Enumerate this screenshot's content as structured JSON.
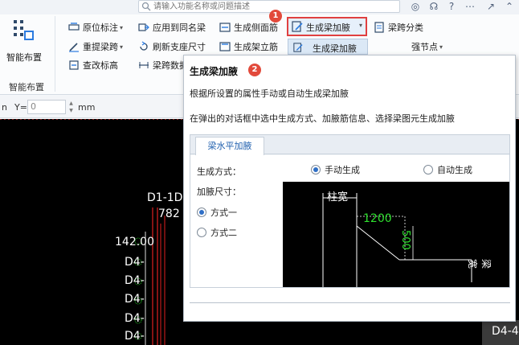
{
  "search": {
    "placeholder": "请输入功能名称或问题描述"
  },
  "ribbon": {
    "smart_layout_label": "智能布置",
    "group_label": "智能布置",
    "col1": [
      "原位标注",
      "重提梁跨",
      "查改标高"
    ],
    "col2": [
      "应用到同名梁",
      "刷新支座尺寸",
      "梁跨数据"
    ],
    "col3": [
      "生成侧面筋",
      "生成架立筋"
    ],
    "highlighted": "生成梁加腋",
    "menu_item": "生成梁加腋",
    "right1": "梁跨分类",
    "right2": "强节点"
  },
  "badges": {
    "first": "1",
    "second": "2"
  },
  "coords": {
    "y_label": "Y=",
    "y_value": "0",
    "unit": "mm",
    "left_trunc": "n"
  },
  "tooltip": {
    "title": "生成梁加腋",
    "desc1": "根据所设置的属性手动或自动生成梁加腋",
    "desc2": "在弹出的对话框中选中生成方式、加腋筋信息、选择梁图元生成加腋",
    "tab": "梁水平加腋",
    "gen_mode_label": "生成方式：",
    "manual": "手动生成",
    "auto": "自动生成",
    "size_label": "加腋尺寸：",
    "mode1": "方式一",
    "mode2": "方式二",
    "diagram": {
      "column_width": "柱宽",
      "dim1": "1200",
      "dim2": "500",
      "beam_width": "梁宽"
    }
  },
  "canvas_labels": [
    "D1-1D",
    "782",
    "142.00",
    "D4-",
    "D4-",
    "D4-",
    "D4-",
    "D4-",
    "D4-",
    "D4-4"
  ],
  "colors": {
    "accent": "#e24a3b",
    "highlight_border": "#e04040",
    "canvas_bg": "#000000",
    "dim_green": "#2ee02e",
    "rebar_red": "#e02020"
  }
}
